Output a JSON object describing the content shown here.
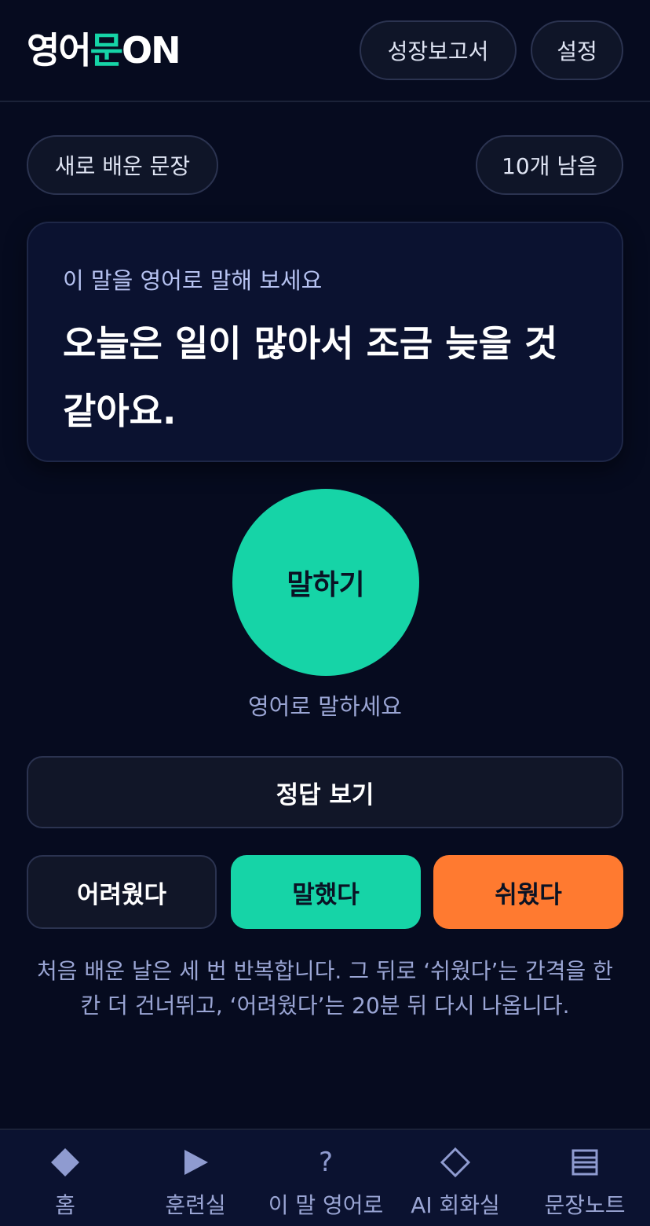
{
  "header": {
    "logo": {
      "part1": "영어",
      "part2": "문",
      "part3": "ON"
    },
    "report_label": "성장보고서",
    "settings_label": "설정"
  },
  "session": {
    "mode_label": "새로 배운 문장",
    "remaining_label": "10개 남음"
  },
  "prompt": {
    "hint": "이 말을 영어로 말해 보세요",
    "sentence": "오늘은 일이 많아서 조금 늦을 것 같아요."
  },
  "speak": {
    "button_label": "말하기",
    "caption": "영어로 말하세요"
  },
  "answer": {
    "label": "정답 보기"
  },
  "rating": {
    "hard_label": "어려웠다",
    "said_label": "말했다",
    "easy_label": "쉬웠다"
  },
  "note": "처음 배운 날은 세 번 반복합니다. 그 뒤로 ‘쉬웠다’는 간격을 한 칸 더 건너뛰고, ‘어려웠다’는 20분 뒤 다시 나옵니다.",
  "nav": {
    "items": [
      {
        "label": "홈",
        "icon": "diamond-filled-icon"
      },
      {
        "label": "훈련실",
        "icon": "play-icon"
      },
      {
        "label": "이 말 영어로",
        "icon": "question-icon"
      },
      {
        "label": "AI 회화실",
        "icon": "diamond-outline-icon"
      },
      {
        "label": "문장노트",
        "icon": "list-icon"
      }
    ]
  },
  "colors": {
    "background": "#060b1f",
    "accent": "#16d4a7",
    "easy": "#ff7a30",
    "card": "#0b1230"
  }
}
